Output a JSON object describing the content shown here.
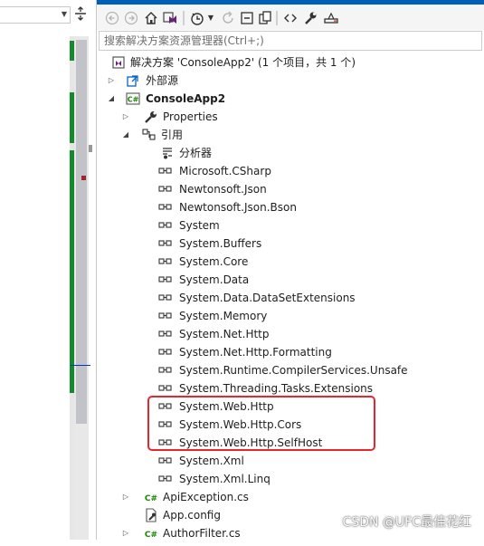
{
  "search": {
    "placeholder": "搜索解决方案资源管理器(Ctrl+;)"
  },
  "solution": {
    "label": "解决方案 'ConsoleApp2' (1 个项目，共 1 个)"
  },
  "tree": {
    "external_sources": "外部源",
    "project": "ConsoleApp2",
    "properties": "Properties",
    "references": "引用",
    "analyzers": "分析器",
    "reference_items": [
      "Microsoft.CSharp",
      "Newtonsoft.Json",
      "Newtonsoft.Json.Bson",
      "System",
      "System.Buffers",
      "System.Core",
      "System.Data",
      "System.Data.DataSetExtensions",
      "System.Memory",
      "System.Net.Http",
      "System.Net.Http.Formatting",
      "System.Runtime.CompilerServices.Unsafe",
      "System.Threading.Tasks.Extensions",
      "System.Web.Http",
      "System.Web.Http.Cors",
      "System.Web.Http.SelfHost",
      "System.Xml",
      "System.Xml.Linq"
    ],
    "files": [
      {
        "name": "ApiException.cs",
        "icon": "csharp-file-icon"
      },
      {
        "name": "App.config",
        "icon": "config-file-icon"
      },
      {
        "name": "AuthorFilter.cs",
        "icon": "csharp-file-icon"
      }
    ]
  },
  "icons": {
    "back": "back-arrow-icon",
    "forward": "forward-arrow-icon",
    "home": "home-icon",
    "vs_switch": "switch-views-icon",
    "history": "history-icon",
    "refresh": "refresh-icon",
    "collapse": "collapse-all-icon",
    "copy": "show-all-files-icon",
    "code": "view-code-icon",
    "properties": "wrench-icon",
    "preview": "preview-icon"
  },
  "watermark": "CSDN @UFC最佳花红",
  "colors": {
    "accent": "#005fb8",
    "change_green": "#148a2c",
    "highlight_red": "#e8262e",
    "csharp_green": "#178600",
    "vs_purple": "#68217a"
  }
}
